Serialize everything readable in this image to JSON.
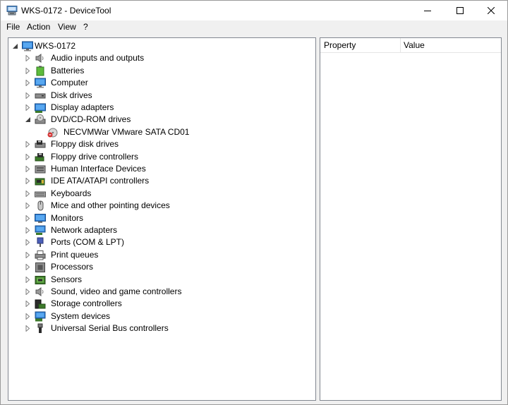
{
  "window": {
    "title": "WKS-0172 - DeviceTool"
  },
  "menu": [
    "File",
    "Action",
    "View",
    "?"
  ],
  "tree": {
    "root": "WKS-0172",
    "categories": [
      {
        "label": "Audio inputs and outputs",
        "icon": "speaker-icon"
      },
      {
        "label": "Batteries",
        "icon": "battery-icon"
      },
      {
        "label": "Computer",
        "icon": "computer-icon"
      },
      {
        "label": "Disk drives",
        "icon": "disk-drive-icon"
      },
      {
        "label": "Display adapters",
        "icon": "display-adapter-icon"
      },
      {
        "label": "DVD/CD-ROM drives",
        "icon": "dvd-drive-icon",
        "expanded": true,
        "children": [
          {
            "label": "NECVMWar VMware SATA CD01",
            "icon": "dvd-device-icon"
          }
        ]
      },
      {
        "label": "Floppy disk drives",
        "icon": "floppy-drive-icon"
      },
      {
        "label": "Floppy drive controllers",
        "icon": "floppy-controller-icon"
      },
      {
        "label": "Human Interface Devices",
        "icon": "hid-icon"
      },
      {
        "label": "IDE ATA/ATAPI controllers",
        "icon": "ide-controller-icon"
      },
      {
        "label": "Keyboards",
        "icon": "keyboard-icon"
      },
      {
        "label": "Mice and other pointing devices",
        "icon": "mouse-icon"
      },
      {
        "label": "Monitors",
        "icon": "monitor-icon"
      },
      {
        "label": "Network adapters",
        "icon": "network-adapter-icon"
      },
      {
        "label": "Ports (COM & LPT)",
        "icon": "port-icon"
      },
      {
        "label": "Print queues",
        "icon": "printer-icon"
      },
      {
        "label": "Processors",
        "icon": "processor-icon"
      },
      {
        "label": "Sensors",
        "icon": "sensor-icon"
      },
      {
        "label": "Sound, video and game controllers",
        "icon": "sound-controller-icon"
      },
      {
        "label": "Storage controllers",
        "icon": "storage-controller-icon"
      },
      {
        "label": "System devices",
        "icon": "system-devices-icon"
      },
      {
        "label": "Universal Serial Bus controllers",
        "icon": "usb-icon"
      }
    ]
  },
  "properties": {
    "columns": [
      "Property",
      "Value"
    ]
  }
}
